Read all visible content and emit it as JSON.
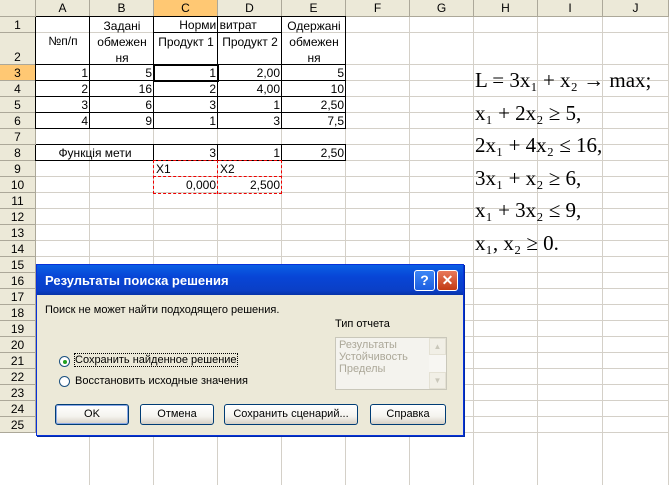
{
  "sheet": {
    "columns": [
      "A",
      "B",
      "C",
      "D",
      "E",
      "F",
      "G",
      "H",
      "I",
      "J"
    ],
    "rows": [
      "1",
      "2",
      "3",
      "4",
      "5",
      "6",
      "7",
      "8",
      "9",
      "10",
      "11",
      "12",
      "13",
      "14",
      "15",
      "16",
      "17",
      "18",
      "19",
      "20",
      "21",
      "22",
      "23",
      "24",
      "25"
    ],
    "header": {
      "a": "№п/п",
      "b": "Задані обмежен ня",
      "cd": "Норми витрат",
      "c2": "Продукт 1",
      "d2": "Продукт 2",
      "e": "Одержані обмежен ня"
    },
    "data": [
      {
        "a": "1",
        "b": "5",
        "c": "1",
        "d": "2,00",
        "e": "5"
      },
      {
        "a": "2",
        "b": "16",
        "c": "2",
        "d": "4,00",
        "e": "10"
      },
      {
        "a": "3",
        "b": "6",
        "c": "3",
        "d": "1",
        "e": "2,50"
      },
      {
        "a": "4",
        "b": "9",
        "c": "1",
        "d": "3",
        "e": "7,5"
      }
    ],
    "objective": {
      "label": "Функція мети",
      "c": "3",
      "d": "1",
      "e": "2,50"
    },
    "vars": {
      "c9": "X1",
      "d9": "X2",
      "c10": "0,000",
      "d10": "2,500"
    }
  },
  "formula": {
    "lines": [
      "L = 3x₁ + x₂ → max;",
      "x₁ + 2x₂ ≥ 5,",
      "2x₁ + 4x₂ ≤ 16,",
      "3x₁ + x₂ ≥ 6,",
      "x₁ + 3x₂ ≤ 9,",
      "x₁, x₂ ≥ 0."
    ]
  },
  "dialog": {
    "title": "Результаты поиска решения",
    "help_label": "?",
    "close_label": "✕",
    "message": "Поиск не может найти подходящего решения.",
    "report_label": "Тип отчета",
    "report_types": [
      "Результаты",
      "Устойчивость",
      "Пределы"
    ],
    "option_keep": "Сохранить найденное решение",
    "option_restore": "Восстановить исходные значения",
    "buttons": {
      "ok": "OK",
      "cancel": "Отмена",
      "save_scenario": "Сохранить сценарий...",
      "help": "Справка"
    }
  }
}
